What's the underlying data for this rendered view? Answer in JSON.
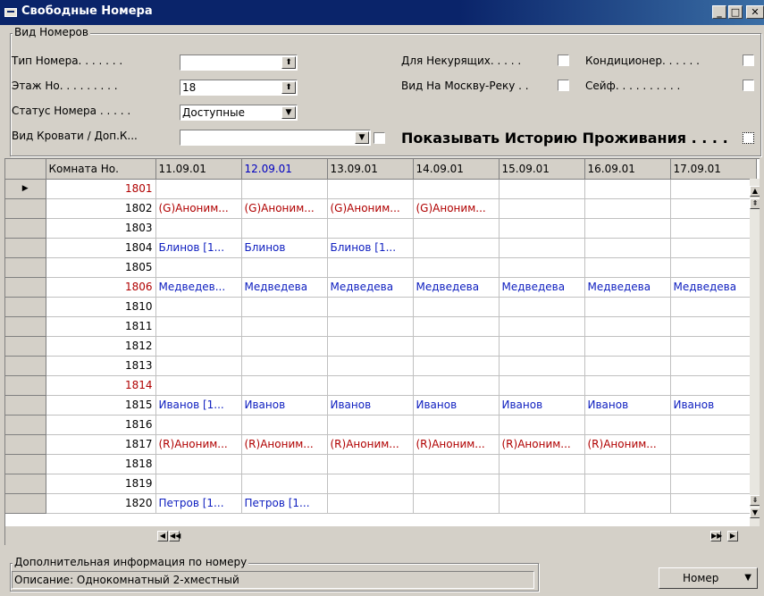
{
  "window": {
    "title": "Свободные Номера"
  },
  "filters": {
    "group_title": "Вид Номеров",
    "room_type_label": "Тип Номера. . . . . . . ",
    "room_type_value": "",
    "floor_label": "Этаж Но. . . . . . . . . ",
    "floor_value": "18",
    "status_label": "Статус Номера . . . . . ",
    "status_value": "Доступные",
    "bed_label": "Вид Кровати / Доп.К...",
    "bed_value": "",
    "nonsmoking_label": "Для Некурящих. . . . . ",
    "conditioner_label": "Кондиционер. . . . . . ",
    "river_view_label": "Вид На Москву-Реку . . ",
    "safe_label": "Сейф. . . . . . . . . . ",
    "history_label": "Показывать Историю Проживания . . . ."
  },
  "grid": {
    "room_header": "Комната Но.",
    "dates": [
      "11.09.01",
      "12.09.01",
      "13.09.01",
      "14.09.01",
      "15.09.01",
      "16.09.01",
      "17.09.01"
    ],
    "selected_date_index": 1,
    "rows": [
      {
        "room": "1801",
        "room_color": "red",
        "current": true,
        "cells": [
          "",
          "",
          "",
          "",
          "",
          "",
          ""
        ]
      },
      {
        "room": "1802",
        "room_color": "black",
        "cells": [
          "(G)Аноним...",
          "(G)Аноним...",
          "(G)Аноним...",
          "(G)Аноним...",
          "",
          "",
          ""
        ],
        "cell_color": "red"
      },
      {
        "room": "1803",
        "room_color": "black",
        "cells": [
          "",
          "",
          "",
          "",
          "",
          "",
          ""
        ]
      },
      {
        "room": "1804",
        "room_color": "black",
        "cells": [
          "Блинов [1...",
          "Блинов",
          "Блинов [1...",
          "",
          "",
          "",
          ""
        ],
        "cell_color": "blue"
      },
      {
        "room": "1805",
        "room_color": "black",
        "cells": [
          "",
          "",
          "",
          "",
          "",
          "",
          ""
        ]
      },
      {
        "room": "1806",
        "room_color": "red",
        "cells": [
          "Медведев...",
          "Медведева",
          "Медведева",
          "Медведева",
          "Медведева",
          "Медведева",
          "Медведева"
        ],
        "cell_color": "blue"
      },
      {
        "room": "1810",
        "room_color": "black",
        "cells": [
          "",
          "",
          "",
          "",
          "",
          "",
          ""
        ]
      },
      {
        "room": "1811",
        "room_color": "black",
        "cells": [
          "",
          "",
          "",
          "",
          "",
          "",
          ""
        ]
      },
      {
        "room": "1812",
        "room_color": "black",
        "cells": [
          "",
          "",
          "",
          "",
          "",
          "",
          ""
        ]
      },
      {
        "room": "1813",
        "room_color": "black",
        "cells": [
          "",
          "",
          "",
          "",
          "",
          "",
          ""
        ]
      },
      {
        "room": "1814",
        "room_color": "red",
        "cells": [
          "",
          "",
          "",
          "",
          "",
          "",
          ""
        ]
      },
      {
        "room": "1815",
        "room_color": "black",
        "cells": [
          "Иванов [1...",
          "Иванов",
          "Иванов",
          "Иванов",
          "Иванов",
          "Иванов",
          "Иванов"
        ],
        "cell_color": "blue"
      },
      {
        "room": "1816",
        "room_color": "black",
        "cells": [
          "",
          "",
          "",
          "",
          "",
          "",
          ""
        ]
      },
      {
        "room": "1817",
        "room_color": "black",
        "cells": [
          "(R)Аноним...",
          "(R)Аноним...",
          "(R)Аноним...",
          "(R)Аноним...",
          "(R)Аноним...",
          "(R)Аноним...",
          ""
        ],
        "cell_color": "red"
      },
      {
        "room": "1818",
        "room_color": "black",
        "cells": [
          "",
          "",
          "",
          "",
          "",
          "",
          ""
        ]
      },
      {
        "room": "1819",
        "room_color": "black",
        "cells": [
          "",
          "",
          "",
          "",
          "",
          "",
          ""
        ]
      },
      {
        "room": "1820",
        "room_color": "black",
        "cells": [
          "Петров [1...",
          "Петров [1...",
          "",
          "",
          "",
          "",
          ""
        ],
        "cell_color": "blue"
      }
    ]
  },
  "info": {
    "group_title": "Дополнительная информация по номеру",
    "description": "Описание: Однокомнатный 2-хместный",
    "button_label": "Номер"
  },
  "colors": {
    "title_bar": "#0a246a",
    "guest_blue": "#1020c0",
    "guest_red": "#b00000",
    "selected_date": "#0000c0"
  }
}
